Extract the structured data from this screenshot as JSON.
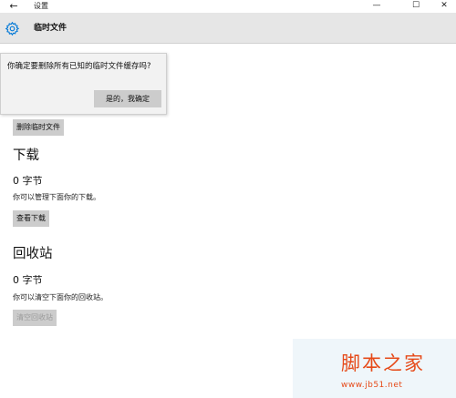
{
  "window": {
    "back_icon": "back-arrow-icon",
    "title": "设置",
    "controls": [
      "minimize-icon",
      "maximize-icon",
      "close-icon"
    ]
  },
  "header": {
    "icon": "gear-icon",
    "title": "临时文件"
  },
  "flyout": {
    "message": "你确定要删除所有已知的临时文件缓存吗?",
    "confirm_label": "是的，我确定"
  },
  "temp_files": {
    "delete_button": "删除临时文件"
  },
  "downloads": {
    "title": "下载",
    "size": "0 字节",
    "description": "你可以管理下面你的下载。",
    "button": "查看下载"
  },
  "recycle_bin": {
    "title": "回收站",
    "size": "0 字节",
    "description": "你可以清空下面你的回收站。",
    "button": "清空回收站"
  },
  "watermark": {
    "text": "脚本之家",
    "url": "www.jb51.net"
  },
  "colors": {
    "header_bg": "#e6e6e6",
    "accent": "#0078d7",
    "button_bg": "#cccccc",
    "watermark": "#e64a19"
  }
}
